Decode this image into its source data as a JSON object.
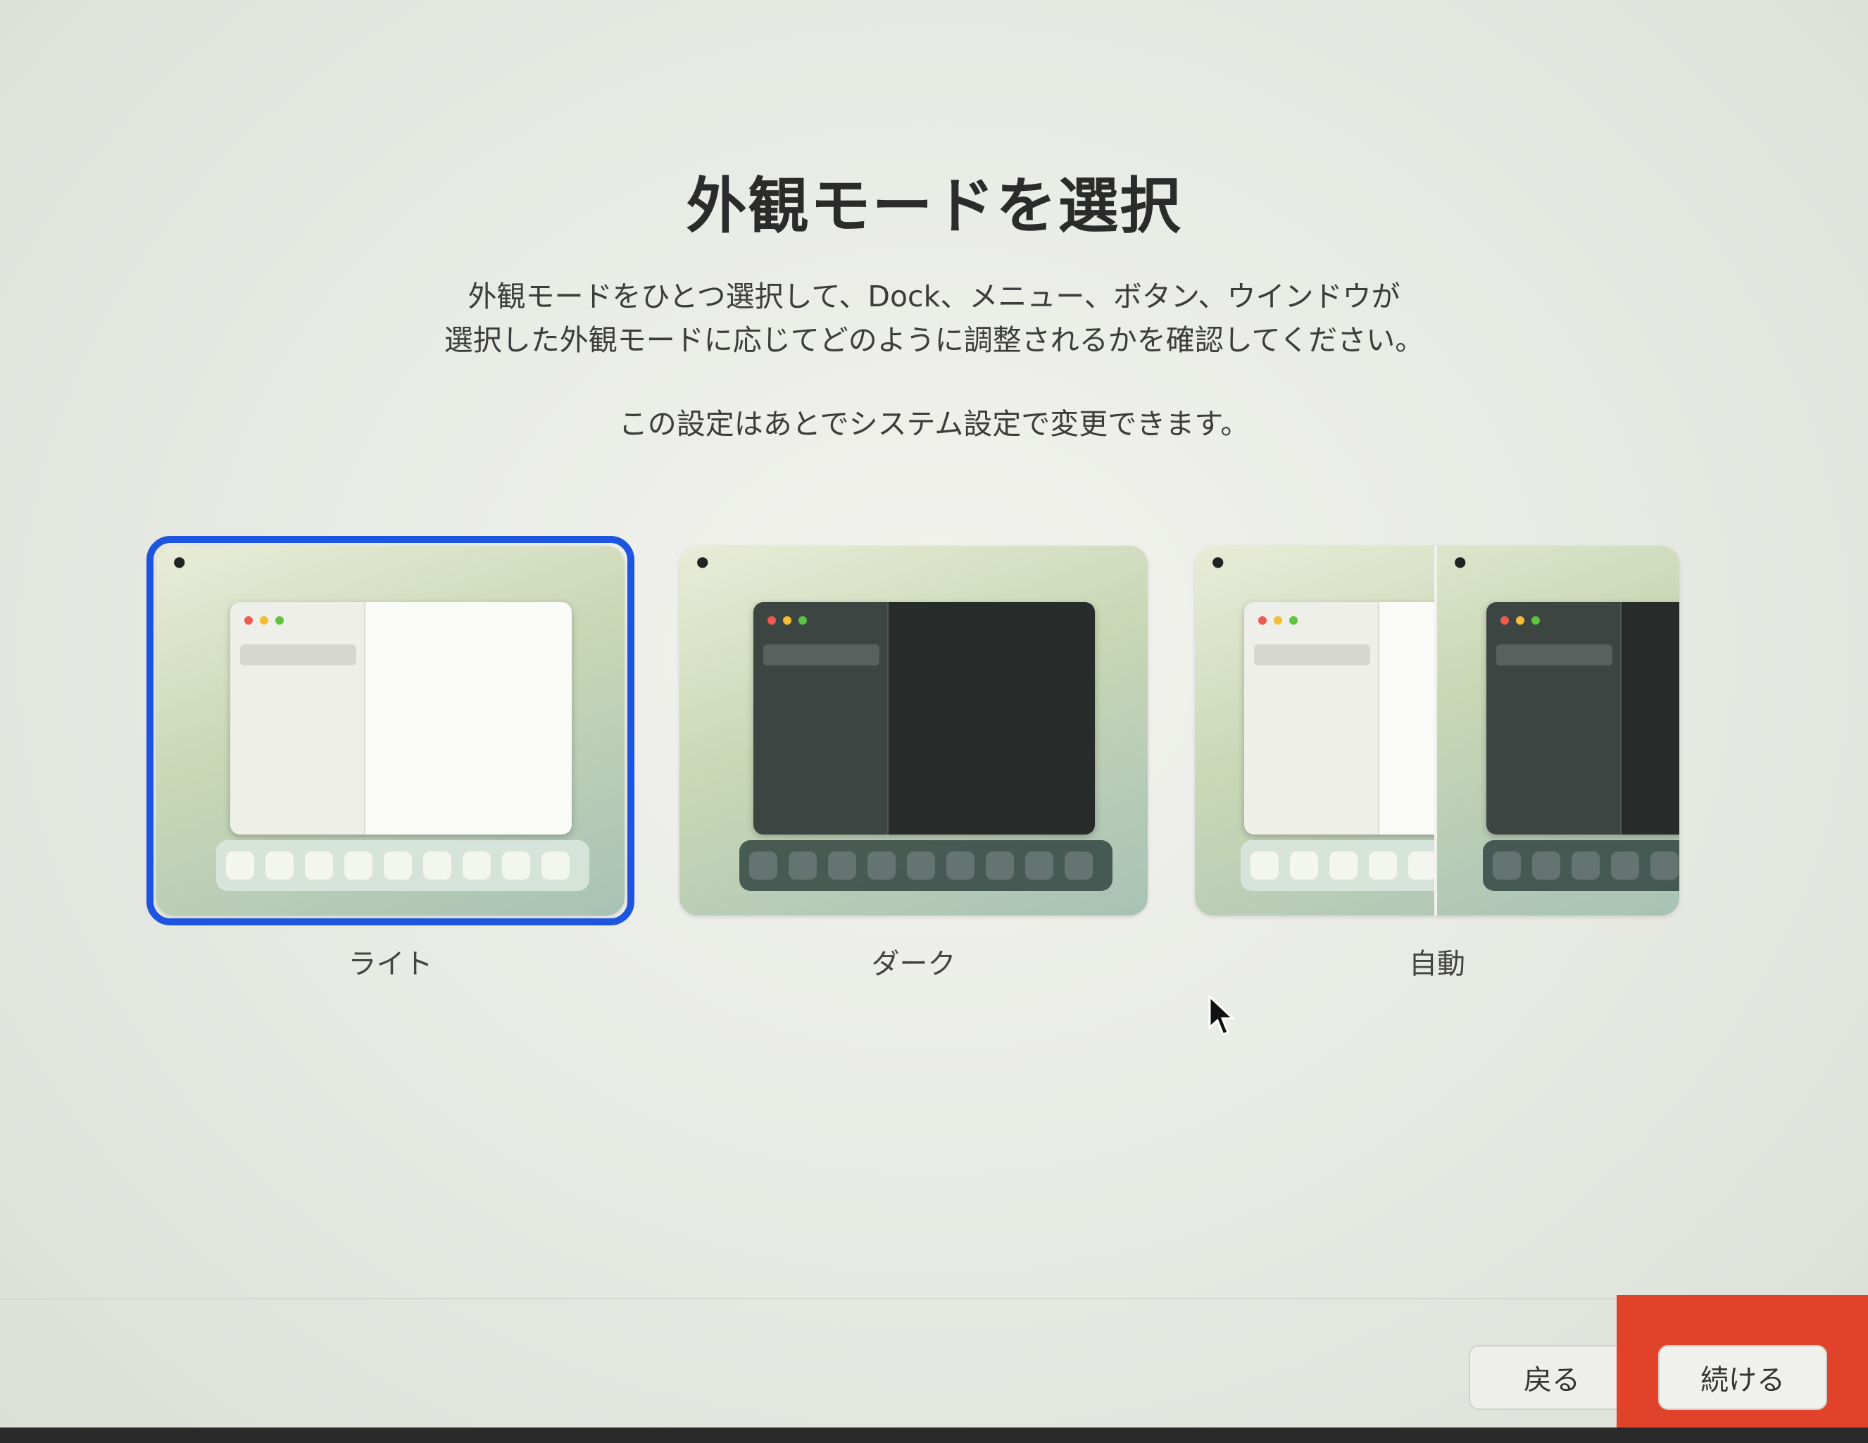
{
  "title": "外観モードを選択",
  "description": {
    "line1": "外観モードをひとつ選択して、Dock、メニュー、ボタン、ウインドウが",
    "line2": "選択した外観モードに応じてどのように調整されるかを確認してください。"
  },
  "note": "この設定はあとでシステム設定で変更できます。",
  "options": [
    {
      "label": "ライト",
      "selected": true
    },
    {
      "label": "ダーク",
      "selected": false
    },
    {
      "label": "自動",
      "selected": false
    }
  ],
  "buttons": {
    "back": "戻る",
    "continue": "続ける"
  },
  "colors": {
    "selection": "#1d55e0",
    "highlight": "#e0432a"
  }
}
